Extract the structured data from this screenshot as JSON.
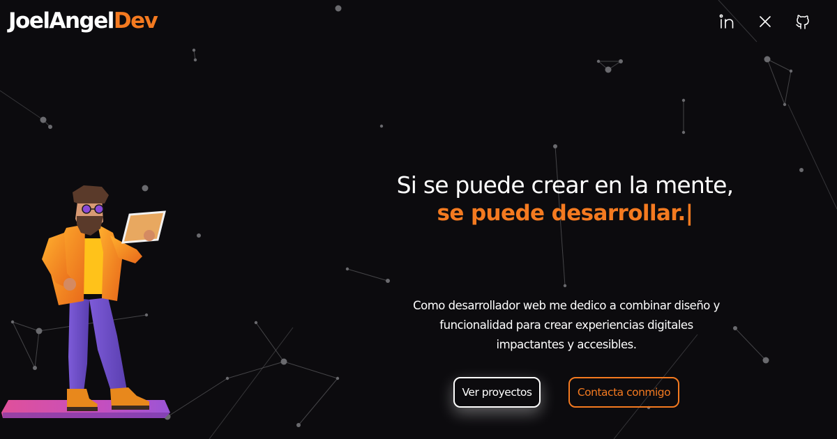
{
  "header": {
    "brand_primary": "JoelAngel",
    "brand_accent": "Dev"
  },
  "socials": [
    {
      "name": "linkedin",
      "icon": "linkedin-icon"
    },
    {
      "name": "x",
      "icon": "x-icon"
    },
    {
      "name": "github",
      "icon": "github-icon"
    }
  ],
  "hero": {
    "heading_line1": "Si se puede crear en la mente,",
    "heading_line2": "se puede desarrollar.",
    "cursor": "|",
    "description": "Como desarrollador web me dedico a combinar diseño y funcionalidad para crear experiencias digitales impactantes y accesibles.",
    "primary_button": "Ver proyectos",
    "secondary_button": "Contacta conmigo"
  },
  "colors": {
    "background": "#0c0b0e",
    "accent": "#f47a20",
    "text": "#ffffff",
    "particle": "#6a6a6e"
  },
  "illustration": "3d-developer-character-with-tablet"
}
